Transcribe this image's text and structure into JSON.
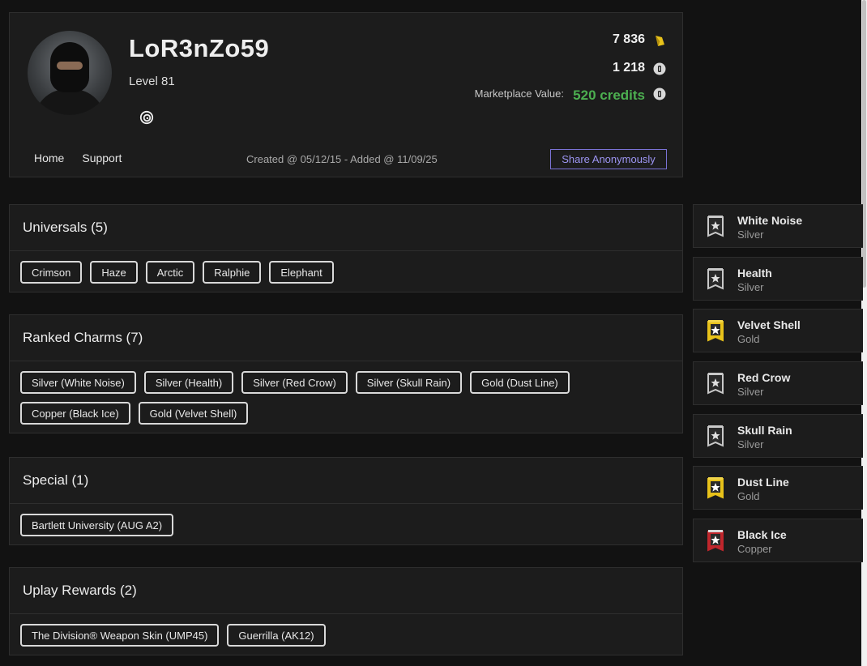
{
  "profile": {
    "username": "LoR3nZo59",
    "level": "Level 81",
    "stats": {
      "renown": "7 836",
      "credits": "1 218",
      "marketplace_label": "Marketplace Value:",
      "marketplace_value": "520 credits"
    },
    "nav": {
      "home": "Home",
      "support": "Support"
    },
    "created": "Created @ 05/12/15 - Added @ 11/09/25",
    "share_label": "Share Anonymously"
  },
  "colors": {
    "accent_green": "#4caf50",
    "share_purple": "#9d95f3",
    "gold": "#e8c21a",
    "copper": "#c0262c"
  },
  "sections": [
    {
      "title": "Universals (5)",
      "tags": [
        "Crimson",
        "Haze",
        "Arctic",
        "Ralphie",
        "Elephant"
      ]
    },
    {
      "title": "Ranked Charms (7)",
      "tags": [
        "Silver (White Noise)",
        "Silver (Health)",
        "Silver (Red Crow)",
        "Silver (Skull Rain)",
        "Gold (Dust Line)",
        "Copper (Black Ice)",
        "Gold (Velvet Shell)"
      ]
    },
    {
      "title": "Special (1)",
      "tags": [
        "Bartlett University (AUG A2)"
      ]
    },
    {
      "title": "Uplay Rewards (2)",
      "tags": [
        "The Division® Weapon Skin (UMP45)",
        "Guerrilla (AK12)"
      ]
    }
  ],
  "charms": [
    {
      "name": "White Noise",
      "tier": "Silver",
      "icon": "silver-charm-icon"
    },
    {
      "name": "Health",
      "tier": "Silver",
      "icon": "silver-charm-icon"
    },
    {
      "name": "Velvet Shell",
      "tier": "Gold",
      "icon": "gold-charm-icon"
    },
    {
      "name": "Red Crow",
      "tier": "Silver",
      "icon": "silver-charm-icon"
    },
    {
      "name": "Skull Rain",
      "tier": "Silver",
      "icon": "silver-charm-icon"
    },
    {
      "name": "Dust Line",
      "tier": "Gold",
      "icon": "gold-charm-icon"
    },
    {
      "name": "Black Ice",
      "tier": "Copper",
      "icon": "copper-charm-icon"
    }
  ]
}
